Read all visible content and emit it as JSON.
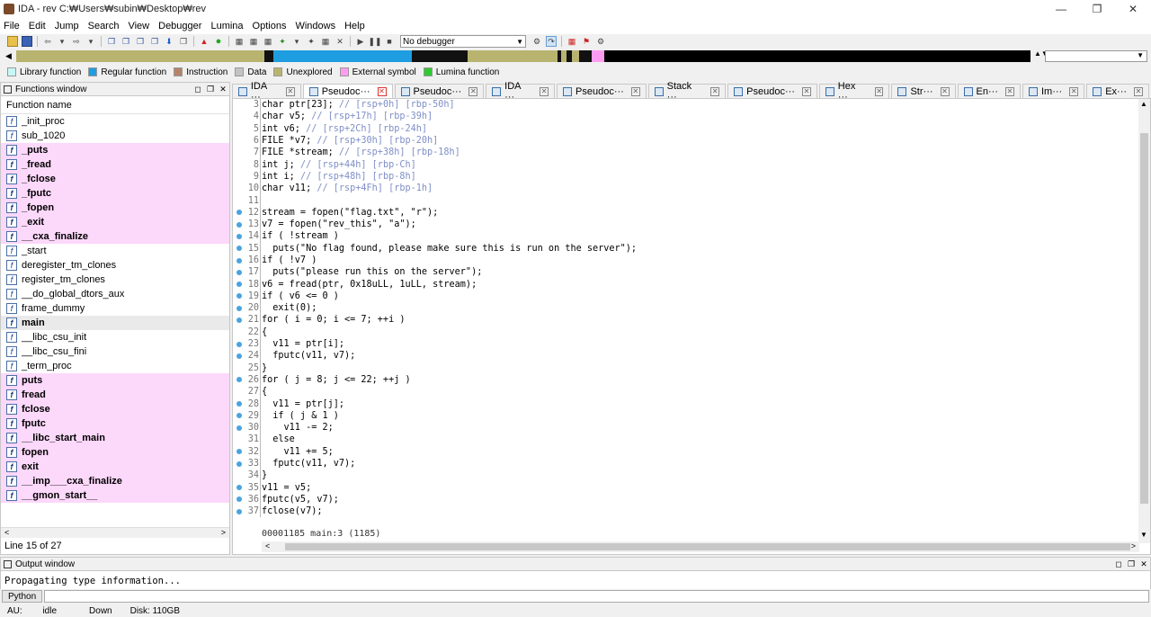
{
  "window": {
    "title": "IDA - rev C:₩Users₩subin₩Desktop₩rev"
  },
  "menu": [
    "File",
    "Edit",
    "Jump",
    "Search",
    "View",
    "Debugger",
    "Lumina",
    "Options",
    "Windows",
    "Help"
  ],
  "toolbar": {
    "debugger_select": "No debugger"
  },
  "legend": [
    {
      "label": "Library function",
      "color": "#c9f7f7"
    },
    {
      "label": "Regular function",
      "color": "#1e9de0"
    },
    {
      "label": "Instruction",
      "color": "#b5836a"
    },
    {
      "label": "Data",
      "color": "#c3c3c3"
    },
    {
      "label": "Unexplored",
      "color": "#b8b470"
    },
    {
      "label": "External symbol",
      "color": "#ff9cf2"
    },
    {
      "label": "Lumina function",
      "color": "#32c832"
    }
  ],
  "functions_window": {
    "title": "Functions window",
    "header": "Function name",
    "items": [
      {
        "name": "_init_proc",
        "style": "normal"
      },
      {
        "name": "sub_1020",
        "style": "normal"
      },
      {
        "name": "_puts",
        "style": "lib"
      },
      {
        "name": "_fread",
        "style": "lib"
      },
      {
        "name": "_fclose",
        "style": "lib"
      },
      {
        "name": "_fputc",
        "style": "lib"
      },
      {
        "name": "_fopen",
        "style": "lib"
      },
      {
        "name": "_exit",
        "style": "lib"
      },
      {
        "name": "__cxa_finalize",
        "style": "lib"
      },
      {
        "name": "_start",
        "style": "normal"
      },
      {
        "name": "deregister_tm_clones",
        "style": "normal"
      },
      {
        "name": "register_tm_clones",
        "style": "normal"
      },
      {
        "name": "__do_global_dtors_aux",
        "style": "normal"
      },
      {
        "name": "frame_dummy",
        "style": "normal"
      },
      {
        "name": "main",
        "style": "sel"
      },
      {
        "name": "__libc_csu_init",
        "style": "normal"
      },
      {
        "name": "__libc_csu_fini",
        "style": "normal"
      },
      {
        "name": "_term_proc",
        "style": "normal"
      },
      {
        "name": "puts",
        "style": "lib"
      },
      {
        "name": "fread",
        "style": "lib"
      },
      {
        "name": "fclose",
        "style": "lib"
      },
      {
        "name": "fputc",
        "style": "lib"
      },
      {
        "name": "__libc_start_main",
        "style": "lib"
      },
      {
        "name": "fopen",
        "style": "lib"
      },
      {
        "name": "exit",
        "style": "lib"
      },
      {
        "name": "__imp___cxa_finalize",
        "style": "lib"
      },
      {
        "name": "__gmon_start__",
        "style": "lib"
      }
    ],
    "status": "Line 15 of 27"
  },
  "tabs": [
    {
      "label": "IDA ···",
      "active": false
    },
    {
      "label": "Pseudoc···",
      "active": true
    },
    {
      "label": "Pseudoc···",
      "active": false
    },
    {
      "label": "IDA ···",
      "active": false
    },
    {
      "label": "Pseudoc···",
      "active": false
    },
    {
      "label": "Stack ···",
      "active": false
    },
    {
      "label": "Pseudoc···",
      "active": false
    },
    {
      "label": "Hex ···",
      "active": false
    },
    {
      "label": "Str···",
      "active": false
    },
    {
      "label": "En···",
      "active": false
    },
    {
      "label": "Im···",
      "active": false
    },
    {
      "label": "Ex···",
      "active": false
    }
  ],
  "code_lines": [
    {
      "n": 3,
      "bp": false,
      "code": "char ptr[23]; ",
      "cm": "// [rsp+0h] [rbp-50h]"
    },
    {
      "n": 4,
      "bp": false,
      "code": "char v5; ",
      "cm": "// [rsp+17h] [rbp-39h]"
    },
    {
      "n": 5,
      "bp": false,
      "code": "int v6; ",
      "cm": "// [rsp+2Ch] [rbp-24h]"
    },
    {
      "n": 6,
      "bp": false,
      "code": "FILE *v7; ",
      "cm": "// [rsp+30h] [rbp-20h]"
    },
    {
      "n": 7,
      "bp": false,
      "code": "FILE *stream; ",
      "cm": "// [rsp+38h] [rbp-18h]"
    },
    {
      "n": 8,
      "bp": false,
      "code": "int j; ",
      "cm": "// [rsp+44h] [rbp-Ch]"
    },
    {
      "n": 9,
      "bp": false,
      "code": "int i; ",
      "cm": "// [rsp+48h] [rbp-8h]"
    },
    {
      "n": 10,
      "bp": false,
      "code": "char v11; ",
      "cm": "// [rsp+4Fh] [rbp-1h]"
    },
    {
      "n": 11,
      "bp": false,
      "code": "",
      "cm": ""
    },
    {
      "n": 12,
      "bp": true,
      "code": "stream = fopen(\"flag.txt\", \"r\");",
      "cm": ""
    },
    {
      "n": 13,
      "bp": true,
      "code": "v7 = fopen(\"rev_this\", \"a\");",
      "cm": ""
    },
    {
      "n": 14,
      "bp": true,
      "code": "if ( !stream )",
      "cm": ""
    },
    {
      "n": 15,
      "bp": true,
      "code": "  puts(\"No flag found, please make sure this is run on the server\");",
      "cm": ""
    },
    {
      "n": 16,
      "bp": true,
      "code": "if ( !v7 )",
      "cm": ""
    },
    {
      "n": 17,
      "bp": true,
      "code": "  puts(\"please run this on the server\");",
      "cm": ""
    },
    {
      "n": 18,
      "bp": true,
      "code": "v6 = fread(ptr, 0x18uLL, 1uLL, stream);",
      "cm": ""
    },
    {
      "n": 19,
      "bp": true,
      "code": "if ( v6 <= 0 )",
      "cm": ""
    },
    {
      "n": 20,
      "bp": true,
      "code": "  exit(0);",
      "cm": ""
    },
    {
      "n": 21,
      "bp": true,
      "code": "for ( i = 0; i <= 7; ++i )",
      "cm": ""
    },
    {
      "n": 22,
      "bp": false,
      "code": "{",
      "cm": ""
    },
    {
      "n": 23,
      "bp": true,
      "code": "  v11 = ptr[i];",
      "cm": ""
    },
    {
      "n": 24,
      "bp": true,
      "code": "  fputc(v11, v7);",
      "cm": ""
    },
    {
      "n": 25,
      "bp": false,
      "code": "}",
      "cm": ""
    },
    {
      "n": 26,
      "bp": true,
      "code": "for ( j = 8; j <= 22; ++j )",
      "cm": ""
    },
    {
      "n": 27,
      "bp": false,
      "code": "{",
      "cm": ""
    },
    {
      "n": 28,
      "bp": true,
      "code": "  v11 = ptr[j];",
      "cm": ""
    },
    {
      "n": 29,
      "bp": true,
      "code": "  if ( j & 1 )",
      "cm": ""
    },
    {
      "n": 30,
      "bp": true,
      "code": "    v11 -= 2;",
      "cm": ""
    },
    {
      "n": 31,
      "bp": false,
      "code": "  else",
      "cm": ""
    },
    {
      "n": 32,
      "bp": true,
      "code": "    v11 += 5;",
      "cm": ""
    },
    {
      "n": 33,
      "bp": true,
      "code": "  fputc(v11, v7);",
      "cm": ""
    },
    {
      "n": 34,
      "bp": false,
      "code": "}",
      "cm": ""
    },
    {
      "n": 35,
      "bp": true,
      "code": "v11 = v5;",
      "cm": ""
    },
    {
      "n": 36,
      "bp": true,
      "code": "fputc(v5, v7);",
      "cm": ""
    },
    {
      "n": 37,
      "bp": true,
      "code": "fclose(v7);",
      "cm": ""
    }
  ],
  "code_footer": "00001185 main:3 (1185)",
  "output_window": {
    "title": "Output window",
    "text": "Propagating type information..."
  },
  "python_button": "Python",
  "status": {
    "au": "AU:",
    "state": "idle",
    "direction": "Down",
    "disk": "Disk: 110GB"
  }
}
